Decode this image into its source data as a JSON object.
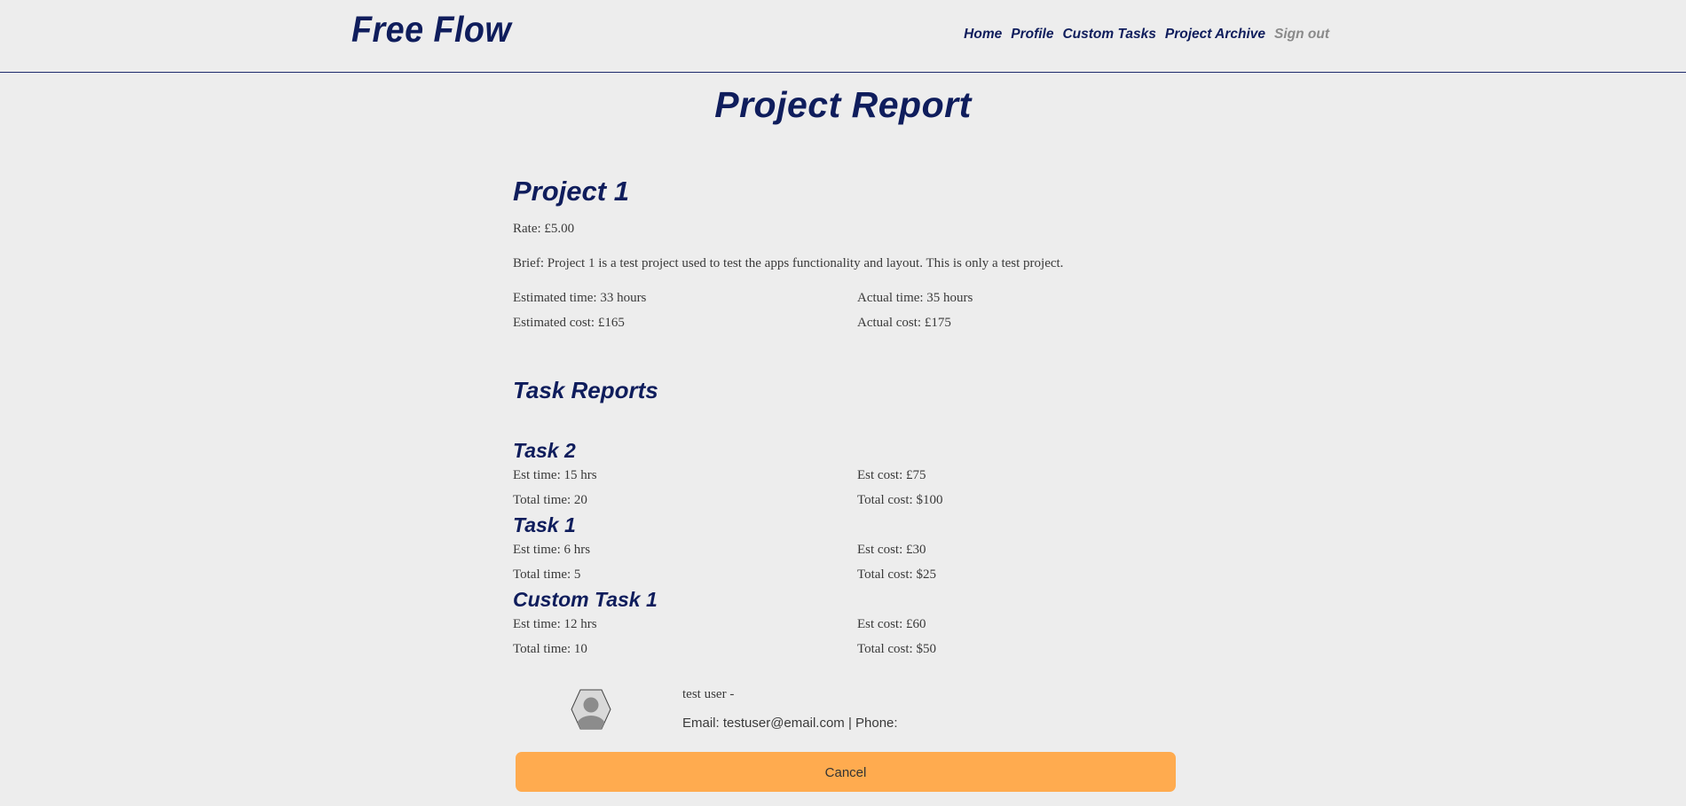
{
  "header": {
    "brand": "Free Flow",
    "nav": [
      "Home",
      "Profile",
      "Custom Tasks",
      "Project Archive",
      "Sign out"
    ]
  },
  "page": {
    "title": "Project Report"
  },
  "project": {
    "name": "Project 1",
    "rate": "Rate: £5.00",
    "brief": "Brief: Project 1 is a test project used to test the apps functionality and layout. This is only a test project.",
    "estimated_time": "Estimated time: 33 hours",
    "actual_time": "Actual time: 35 hours",
    "estimated_cost": "Estimated cost: £165",
    "actual_cost": "Actual cost: £175"
  },
  "task_reports": {
    "title": "Task Reports",
    "tasks": [
      {
        "name": "Task 2",
        "est_time": "Est time: 15 hrs",
        "est_cost": "Est cost: £75",
        "total_time": "Total time: 20",
        "total_cost": "Total cost: $100"
      },
      {
        "name": "Task 1",
        "est_time": "Est time: 6 hrs",
        "est_cost": "Est cost: £30",
        "total_time": "Total time: 5",
        "total_cost": "Total cost: $25"
      },
      {
        "name": "Custom Task 1",
        "est_time": "Est time: 12 hrs",
        "est_cost": "Est cost: £60",
        "total_time": "Total time: 10",
        "total_cost": "Total cost: $50"
      }
    ]
  },
  "user": {
    "name": "test user -",
    "contact": "Email: testuser@email.com | Phone:"
  },
  "actions": {
    "cancel_label": "Cancel"
  },
  "colors": {
    "background": "#ededed",
    "brand_navy": "#0f1d5c",
    "muted_link": "#8a8a8a",
    "cancel_button": "#ffab4f"
  },
  "icons": {
    "avatar": "user-avatar-icon"
  }
}
